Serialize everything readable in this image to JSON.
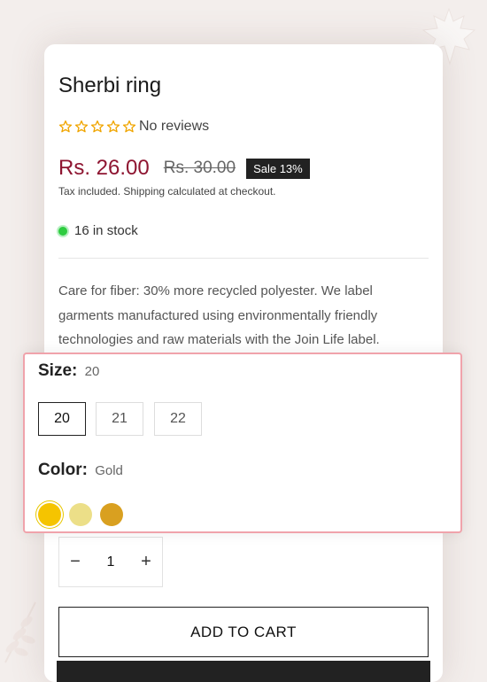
{
  "product": {
    "title": "Sherbi ring",
    "rating": {
      "stars": 5,
      "filled": 0,
      "reviews_text": "No reviews"
    },
    "price": {
      "sale": "Rs. 26.00",
      "compare": "Rs. 30.00",
      "badge": "Sale 13%",
      "tax_note": "Tax included. Shipping calculated at checkout."
    },
    "stock_text": "16 in stock",
    "description": "Care for fiber: 30% more recycled polyester. We label garments manufactured using environmentally friendly technologies and raw materials with the Join Life label."
  },
  "options": {
    "size": {
      "label": "Size:",
      "selected": "20",
      "values": [
        "20",
        "21",
        "22"
      ]
    },
    "color": {
      "label": "Color:",
      "selected": "Gold",
      "swatches": [
        "#f5c400",
        "#ecdf88",
        "#d9a020"
      ]
    }
  },
  "quantity": {
    "minus": "−",
    "value": "1",
    "plus": "+"
  },
  "actions": {
    "add_to_cart": "ADD TO CART"
  },
  "colors": {
    "sale_price": "#8e1531",
    "stock_dot": "#2ecc40",
    "panel_border": "#f0a3ab"
  }
}
